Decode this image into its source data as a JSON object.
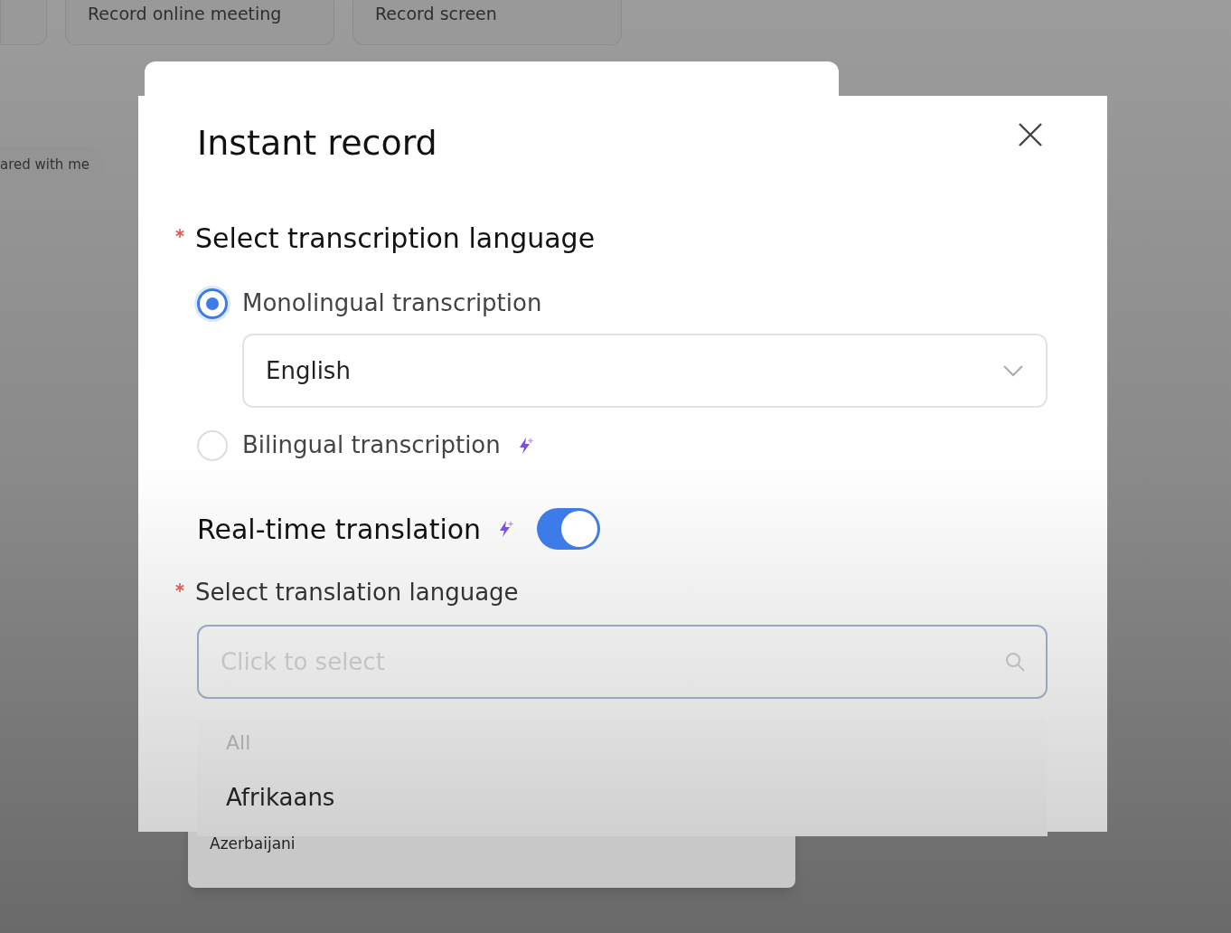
{
  "background": {
    "cards": [
      "Record online meeting",
      "Record screen"
    ],
    "sidebar_item": "ared with me"
  },
  "dialog": {
    "title": "Instant record",
    "transcription": {
      "label": "Select transcription language",
      "required": true,
      "language": "English",
      "options": [
        {
          "label": "Monolingual transcription",
          "selected": true,
          "ai": false
        },
        {
          "label": "Bilingual transcription",
          "selected": false,
          "ai": true
        }
      ]
    },
    "translation": {
      "label": "Real-time translation",
      "ai": true,
      "on": true,
      "language_label": "Select translation language",
      "required": true,
      "placeholder": "Click to select",
      "options": [
        {
          "label": "All",
          "kind": "group"
        },
        {
          "label": "Afrikaans",
          "kind": "language"
        }
      ]
    }
  },
  "back_dropdown": {
    "options": [
      "Azerbaijani"
    ]
  }
}
